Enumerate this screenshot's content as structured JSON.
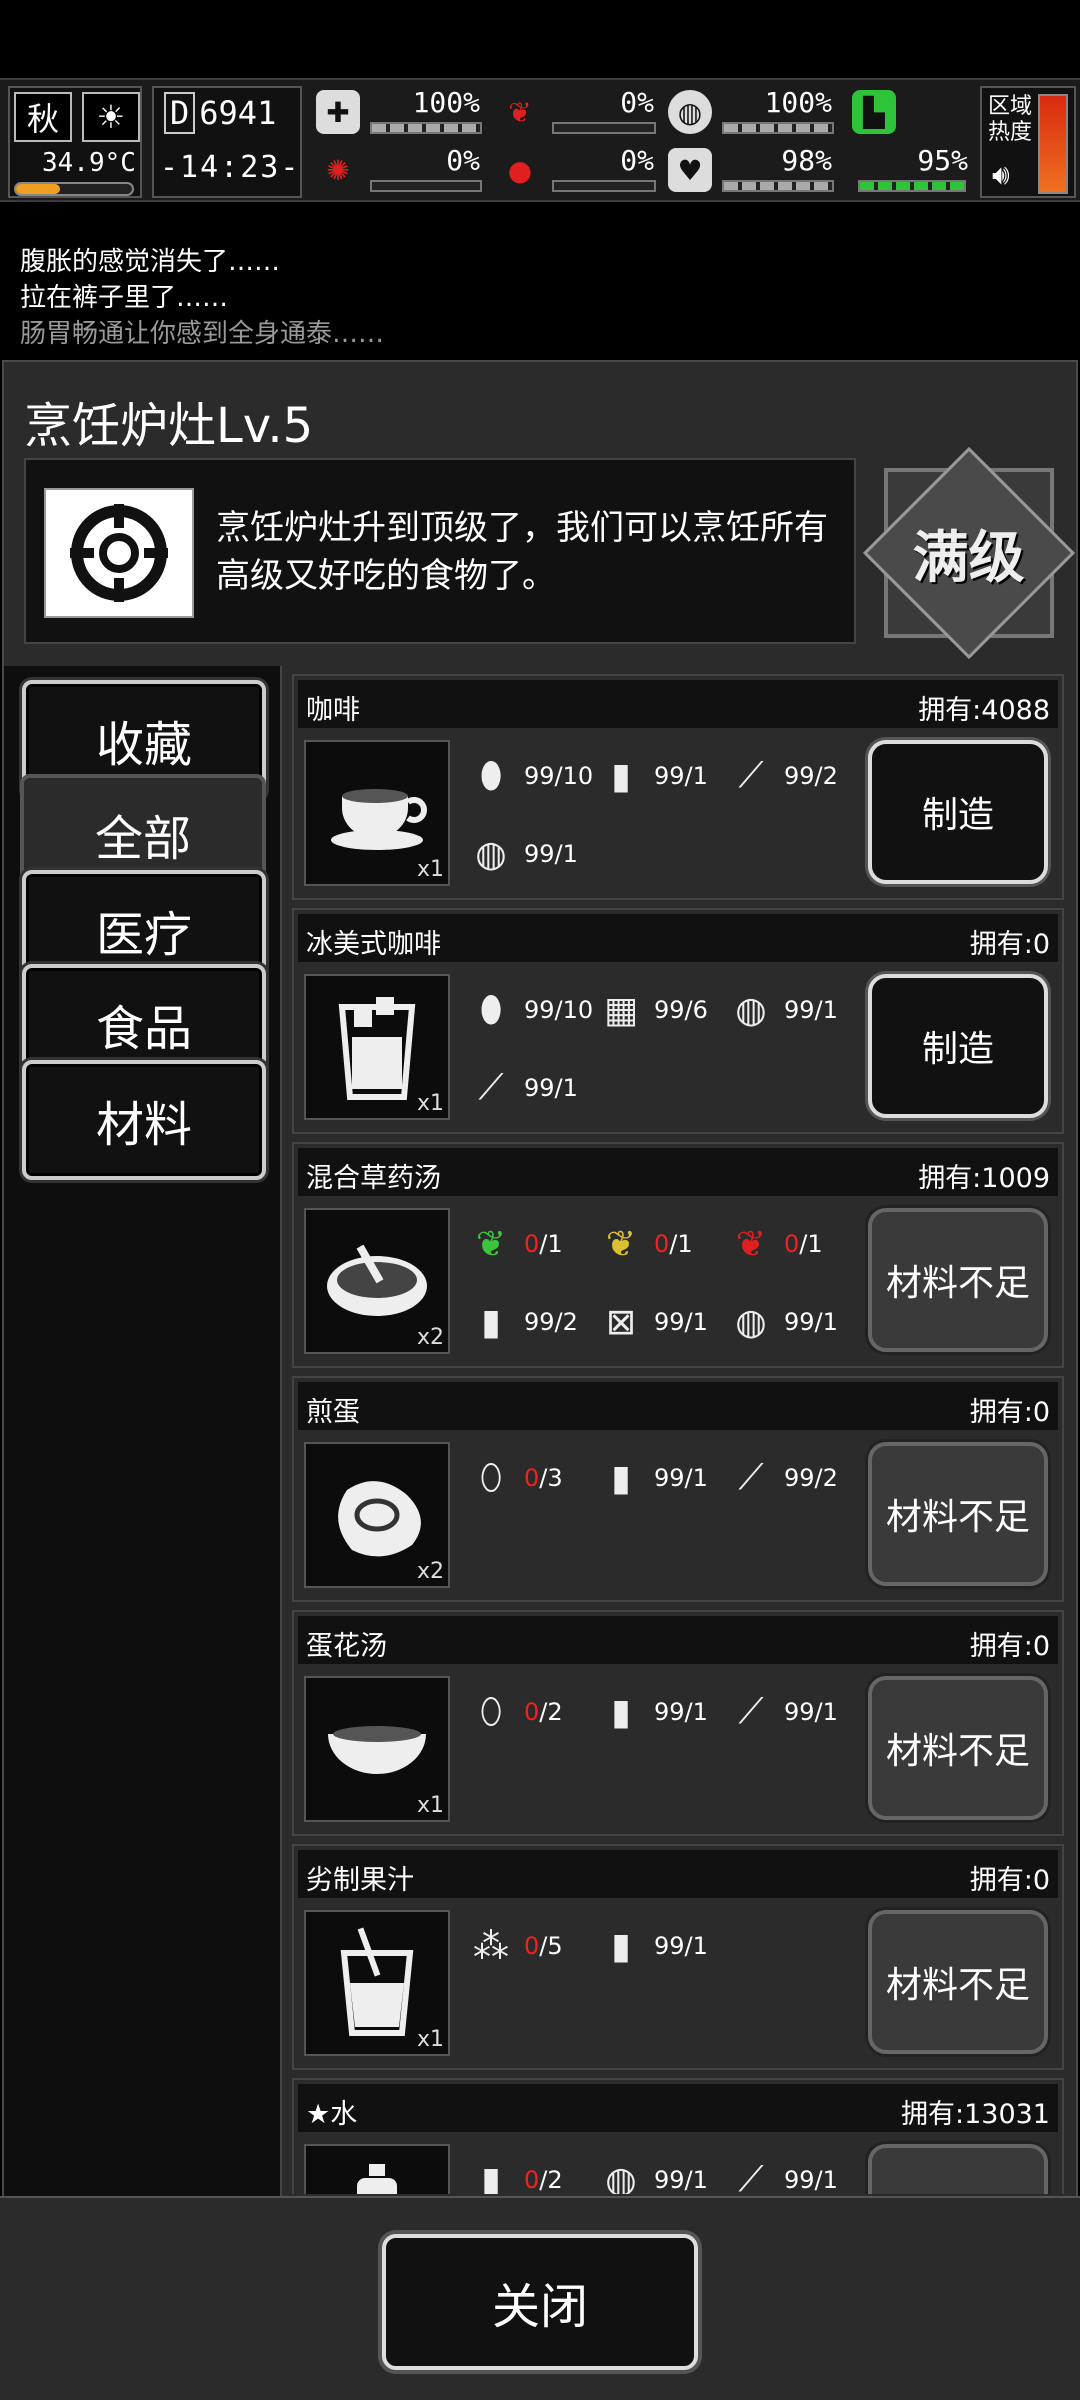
{
  "hud": {
    "season": "秋",
    "temperature": "34.9°C",
    "day_label": "D",
    "day_number": "6941",
    "clock": "-14:23-",
    "stats": [
      {
        "id": "health",
        "icon": "medkit-icon",
        "value": "100%",
        "color": "#cccccc"
      },
      {
        "id": "hunger",
        "icon": "stomach-icon",
        "value": "0%",
        "color": "#e02020"
      },
      {
        "id": "water",
        "icon": "bottle-icon",
        "value": "100%",
        "color": "#cccccc"
      },
      {
        "id": "infection",
        "icon": "brain-icon",
        "value": "0%",
        "color": "#e02020"
      },
      {
        "id": "bleeding",
        "icon": "blood-drop-icon",
        "value": "0%",
        "color": "#e02020"
      },
      {
        "id": "mood",
        "icon": "heart-icon",
        "value": "98%",
        "color": "#2ec43a"
      },
      {
        "id": "stamina",
        "icon": "foot-icon",
        "value": "95%",
        "color": "#2ec43a"
      }
    ],
    "zone_label": "区域热度"
  },
  "log": [
    "腹胀的感觉消失了……",
    "拉在裤子里了……",
    "肠胃畅通让你感到全身通泰……"
  ],
  "panel": {
    "title": "烹饪炉灶Lv.5",
    "description": "烹饪炉灶升到顶级了，我们可以烹饪所有高级又好吃的食物了。",
    "max_badge": "满级"
  },
  "categories": [
    {
      "label": "收藏",
      "active": false
    },
    {
      "label": "全部",
      "active": true
    },
    {
      "label": "医疗",
      "active": false
    },
    {
      "label": "食品",
      "active": false
    },
    {
      "label": "材料",
      "active": false
    }
  ],
  "recipes": [
    {
      "name": "咖啡",
      "owned": "拥有:4088",
      "qty": "x1",
      "button": "制造",
      "ingredients": [
        {
          "icon": "coffee-bean-icon",
          "have": "99",
          "need": "10"
        },
        {
          "icon": "water-bottle-icon",
          "have": "99",
          "need": "1"
        },
        {
          "icon": "firewood-icon",
          "have": "99",
          "need": "2"
        },
        {
          "icon": "filter-icon",
          "have": "99",
          "need": "1"
        }
      ]
    },
    {
      "name": "冰美式咖啡",
      "owned": "拥有:0",
      "qty": "x1",
      "button": "制造",
      "ingredients": [
        {
          "icon": "coffee-bean-icon",
          "have": "99",
          "need": "10"
        },
        {
          "icon": "ice-icon",
          "have": "99",
          "need": "6"
        },
        {
          "icon": "filter-icon",
          "have": "99",
          "need": "1"
        },
        {
          "icon": "glass-bottle-icon",
          "have": "99",
          "need": "1"
        }
      ]
    },
    {
      "name": "混合草药汤",
      "owned": "拥有:1009",
      "qty": "x2",
      "button": "材料不足",
      "ingredients": [
        {
          "icon": "green-herb-icon",
          "have": "0",
          "need": "1"
        },
        {
          "icon": "yellow-herb-icon",
          "have": "0",
          "need": "1"
        },
        {
          "icon": "red-herb-icon",
          "have": "0",
          "need": "1"
        },
        {
          "icon": "water-bottle-icon",
          "have": "99",
          "need": "2"
        },
        {
          "icon": "fuel-can-icon",
          "have": "99",
          "need": "1"
        },
        {
          "icon": "filter-icon",
          "have": "99",
          "need": "1"
        }
      ]
    },
    {
      "name": "煎蛋",
      "owned": "拥有:0",
      "qty": "x2",
      "button": "材料不足",
      "ingredients": [
        {
          "icon": "egg-icon",
          "have": "0",
          "need": "3"
        },
        {
          "icon": "water-bottle-icon",
          "have": "99",
          "need": "1"
        },
        {
          "icon": "firewood-icon",
          "have": "99",
          "need": "2"
        }
      ]
    },
    {
      "name": "蛋花汤",
      "owned": "拥有:0",
      "qty": "x1",
      "button": "材料不足",
      "ingredients": [
        {
          "icon": "egg-icon",
          "have": "0",
          "need": "2"
        },
        {
          "icon": "water-bottle-icon",
          "have": "99",
          "need": "1"
        },
        {
          "icon": "firewood-icon",
          "have": "99",
          "need": "1"
        }
      ]
    },
    {
      "name": "劣制果汁",
      "owned": "拥有:0",
      "qty": "x1",
      "button": "材料不足",
      "ingredients": [
        {
          "icon": "berries-icon",
          "have": "0",
          "need": "5"
        },
        {
          "icon": "water-bottle-icon",
          "have": "99",
          "need": "1"
        }
      ]
    },
    {
      "name": "水",
      "owned": "拥有:13031",
      "qty": "",
      "button": "",
      "favorite": true,
      "ingredients": [
        {
          "icon": "small-bottle-icon",
          "have": "0",
          "need": "2"
        },
        {
          "icon": "filter-icon",
          "have": "99",
          "need": "1"
        },
        {
          "icon": "firewood-icon",
          "have": "99",
          "need": "1"
        }
      ]
    }
  ],
  "footer": {
    "close_label": "关闭"
  }
}
